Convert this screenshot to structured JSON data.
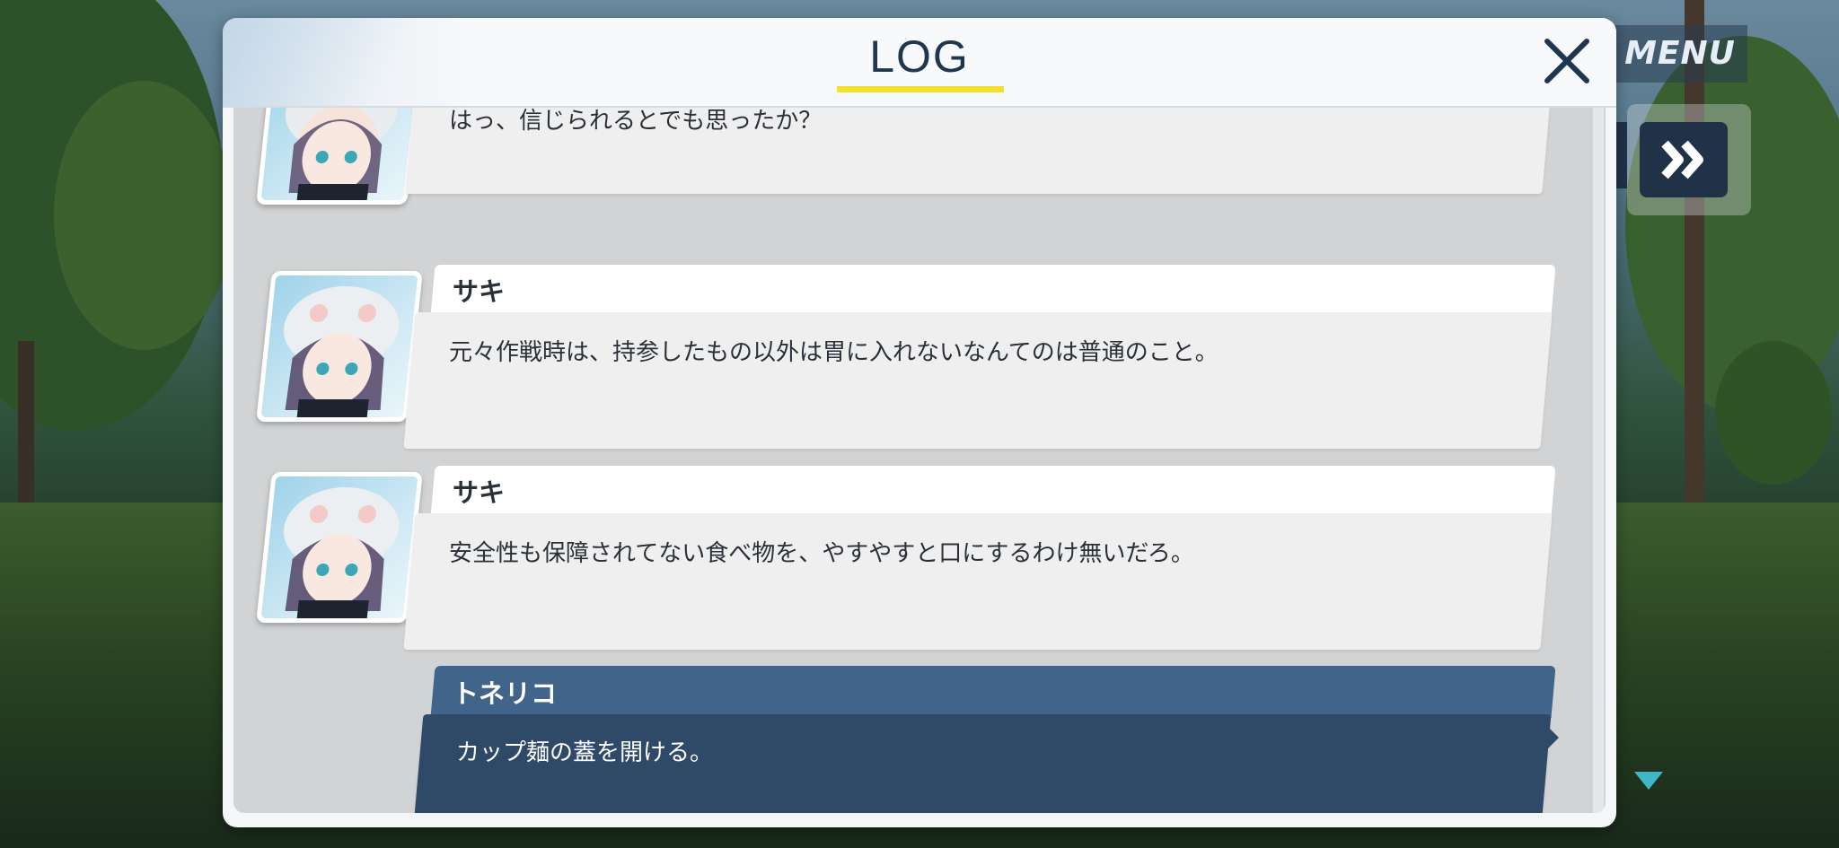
{
  "log": {
    "title": "LOG",
    "close_symbol": "✕"
  },
  "hud": {
    "menu_label": "MENU",
    "fast_forward_symbol": "»"
  },
  "entries": [
    {
      "speaker": "",
      "text": "はっ、信じられるとでも思ったか？",
      "avatar": "saki-portrait"
    },
    {
      "speaker": "サキ",
      "text": "元々作戦時は、持参したもの以外は胃に入れないなんてのは普通のこと。",
      "avatar": "saki-portrait"
    },
    {
      "speaker": "サキ",
      "text": "安全性も保障されてない食べ物を、やすやすと口にするわけ無いだろ。",
      "avatar": "saki-portrait"
    },
    {
      "speaker": "トネリコ",
      "text": "カップ麺の蓋を開ける。",
      "avatar": ""
    }
  ],
  "colors": {
    "accent_yellow": "#f2e12a",
    "title_navy": "#1f3550",
    "player_name_bg": "#41648a",
    "player_text_bg": "#2e4a68"
  }
}
